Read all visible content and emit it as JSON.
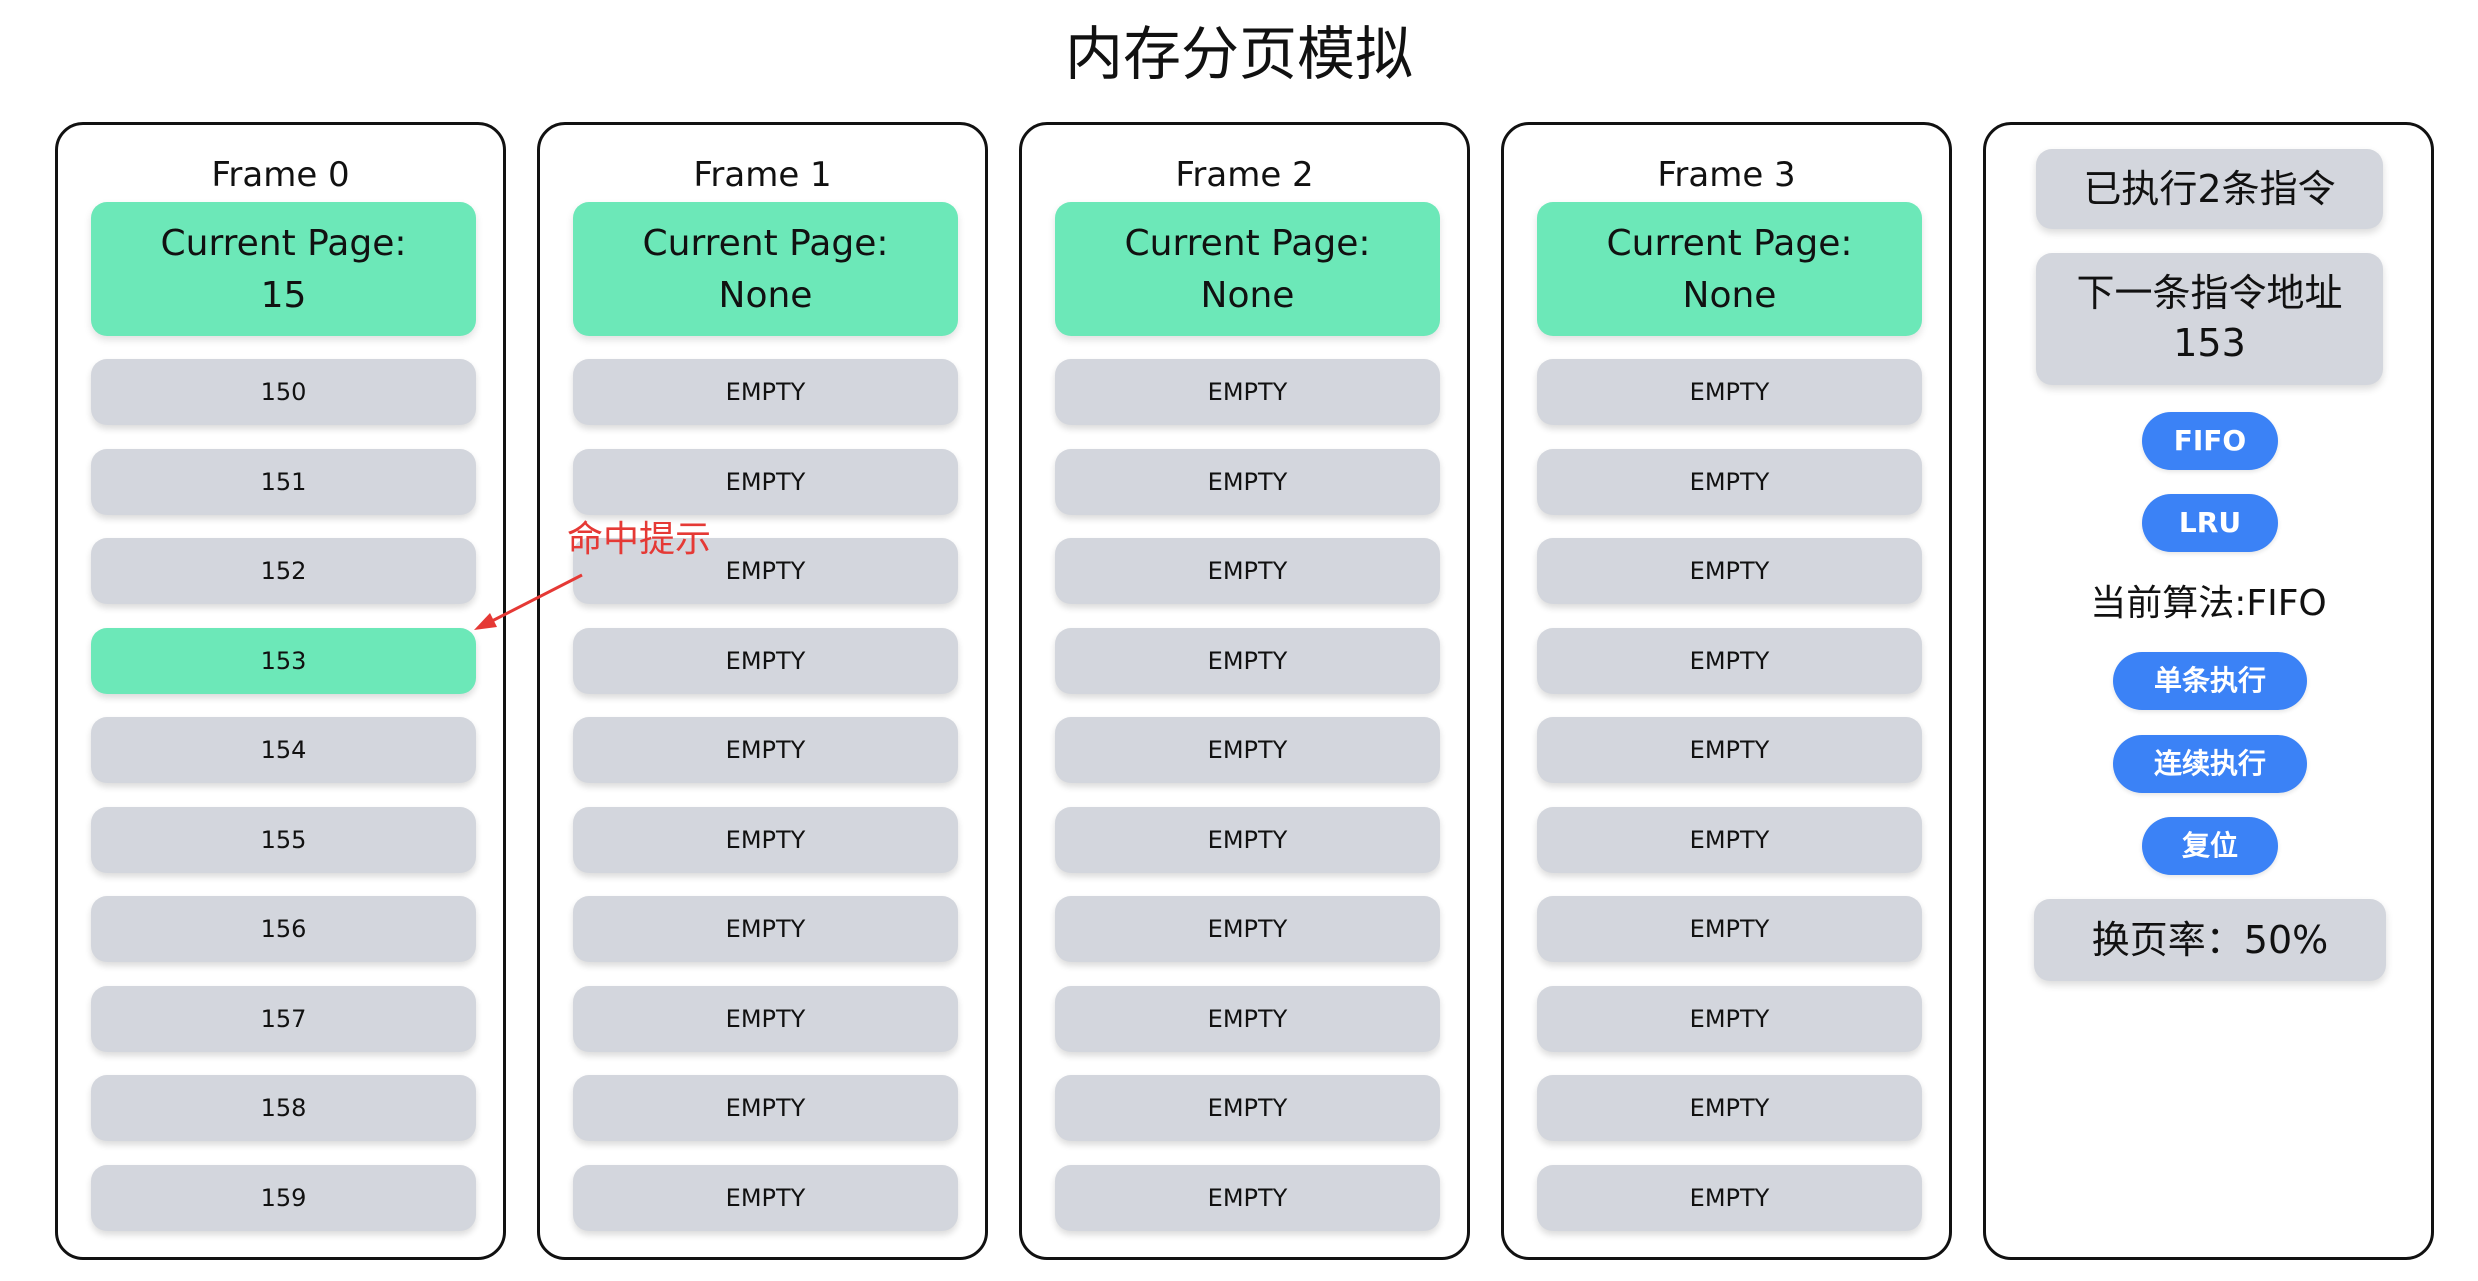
{
  "title": "内存分页模拟",
  "frames": [
    {
      "name": "Frame 0",
      "current_page_label": "Current Page:",
      "current_page_value": "15",
      "slots": [
        "150",
        "151",
        "152",
        "153",
        "154",
        "155",
        "156",
        "157",
        "158",
        "159"
      ],
      "hit_index": 3
    },
    {
      "name": "Frame 1",
      "current_page_label": "Current Page:",
      "current_page_value": "None",
      "slots": [
        "EMPTY",
        "EMPTY",
        "EMPTY",
        "EMPTY",
        "EMPTY",
        "EMPTY",
        "EMPTY",
        "EMPTY",
        "EMPTY",
        "EMPTY"
      ]
    },
    {
      "name": "Frame 2",
      "current_page_label": "Current Page:",
      "current_page_value": "None",
      "slots": [
        "EMPTY",
        "EMPTY",
        "EMPTY",
        "EMPTY",
        "EMPTY",
        "EMPTY",
        "EMPTY",
        "EMPTY",
        "EMPTY",
        "EMPTY"
      ]
    },
    {
      "name": "Frame 3",
      "current_page_label": "Current Page:",
      "current_page_value": "None",
      "slots": [
        "EMPTY",
        "EMPTY",
        "EMPTY",
        "EMPTY",
        "EMPTY",
        "EMPTY",
        "EMPTY",
        "EMPTY",
        "EMPTY",
        "EMPTY"
      ]
    }
  ],
  "control": {
    "executed": "已执行2条指令",
    "next_addr_label": "下一条指令地址",
    "next_addr_value": "153",
    "fifo_button": "FIFO",
    "lru_button": "LRU",
    "current_algo": "当前算法:FIFO",
    "step_button": "单条执行",
    "run_button": "连续执行",
    "reset_button": "复位",
    "fault_rate": "换页率：50%"
  },
  "annotation": {
    "text": "命中提示"
  },
  "colors": {
    "hit": "#6ce8b8",
    "slot": "#d3d6dd",
    "button": "#3b82f6",
    "annotation": "#e53935"
  }
}
